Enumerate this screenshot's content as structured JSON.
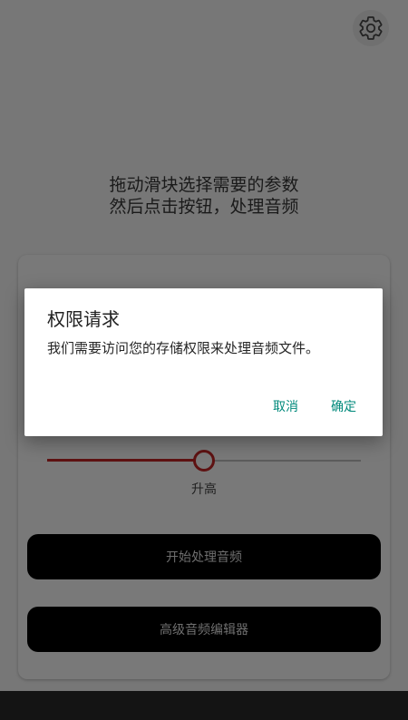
{
  "instructions": {
    "line1": "拖动滑块选择需要的参数",
    "line2": "然后点击按钮，处理音频"
  },
  "settings": {
    "icon": "gear-icon"
  },
  "slider": {
    "value_fraction": 0.5,
    "label": "升高",
    "fill_color": "#5e1212"
  },
  "buttons": {
    "process": "开始处理音频",
    "advanced": "高级音频编辑器"
  },
  "dialog": {
    "title": "权限请求",
    "message": "我们需要访问您的存储权限来处理音频文件。",
    "cancel": "取消",
    "confirm": "确定",
    "accent_color": "#00897b"
  }
}
